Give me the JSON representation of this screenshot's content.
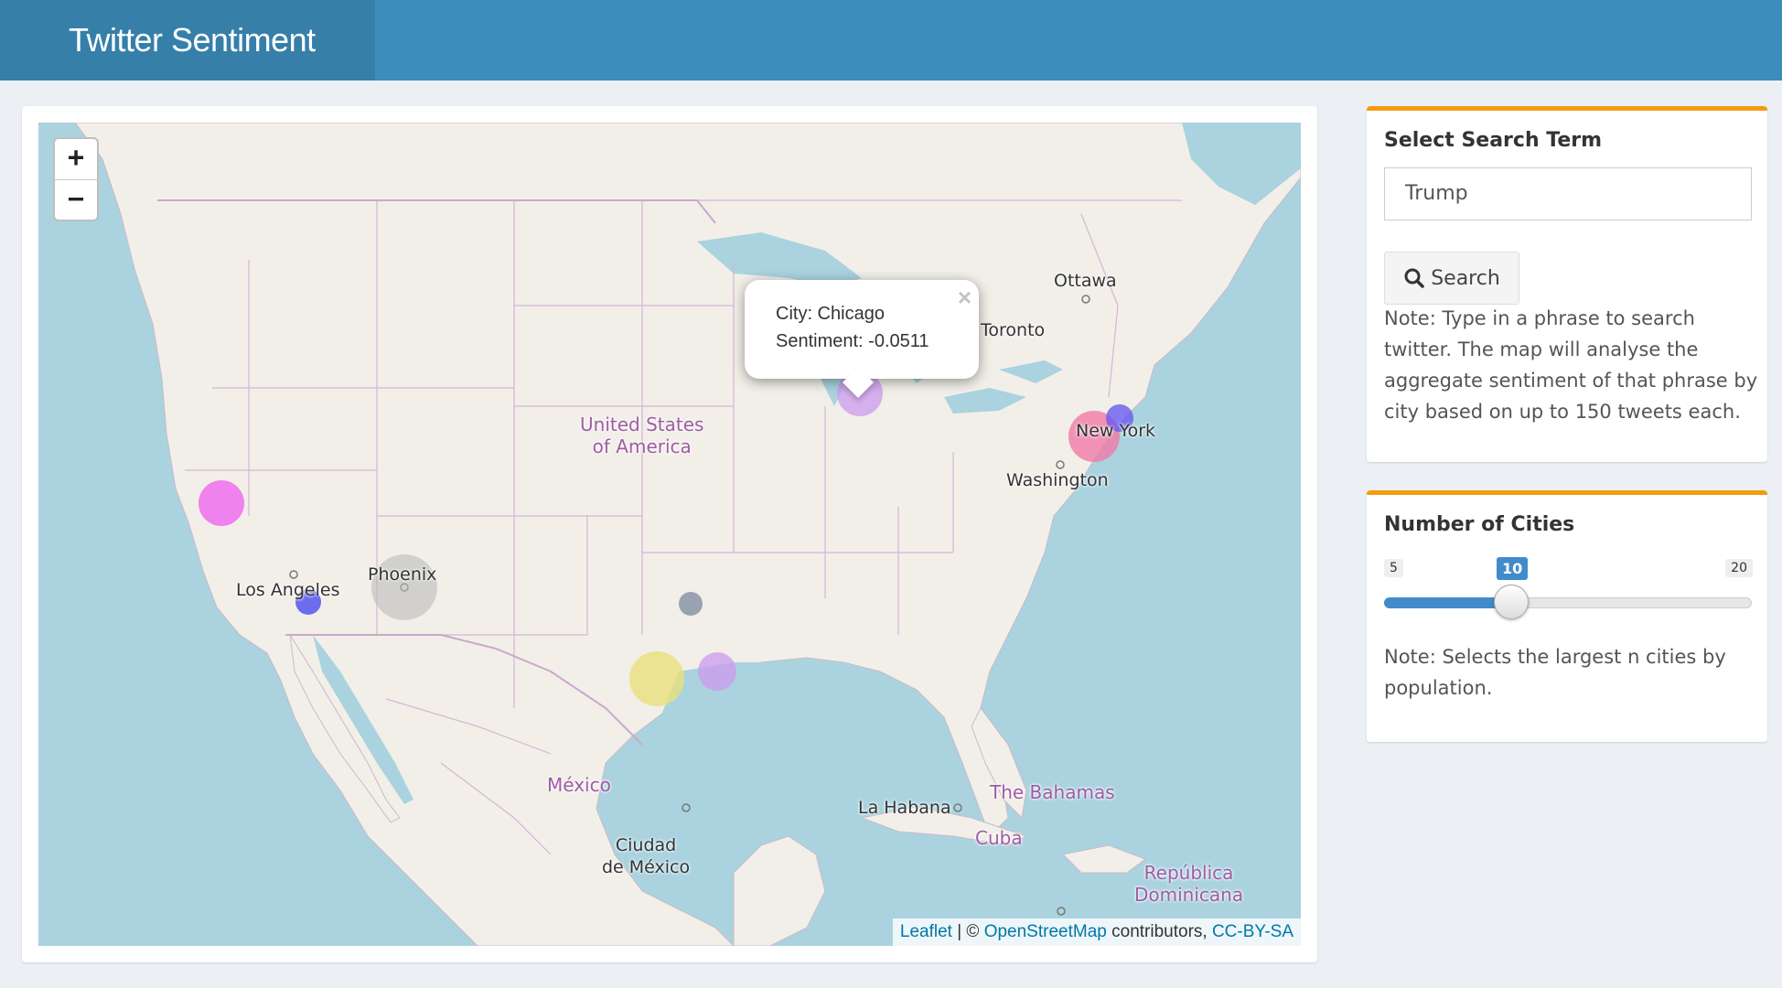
{
  "header": {
    "title": "Twitter Sentiment"
  },
  "map": {
    "zoom_in": "+",
    "zoom_out": "−",
    "labels": {
      "ottawa": "Ottawa",
      "toronto": "Toronto",
      "usa_line1": "United States",
      "usa_line2": "of America",
      "new_york": "New York",
      "washington": "Washington",
      "los_angeles": "Los Angeles",
      "phoenix": "Phoenix",
      "mexico": "México",
      "ciudad_line1": "Ciudad",
      "ciudad_line2": "de México",
      "la_habana": "La Habana",
      "bahamas": "The Bahamas",
      "cuba": "Cuba",
      "dominicana_line1": "República",
      "dominicana_line2": "Dominicana"
    },
    "popup": {
      "city": "City: Chicago",
      "sentiment": "Sentiment: -0.0511",
      "close": "×"
    },
    "attribution": {
      "leaflet": "Leaflet",
      "sep": " | © ",
      "osm": "OpenStreetMap",
      "contrib": " contributors, ",
      "license": "CC-BY-SA"
    },
    "markers": [
      {
        "name": "San Francisco",
        "color": "#ee66ee"
      },
      {
        "name": "Los Angeles",
        "color": "#5555ee"
      },
      {
        "name": "Phoenix",
        "color": "#bbbbbb"
      },
      {
        "name": "Dallas",
        "color": "#8894a6"
      },
      {
        "name": "San Antonio",
        "color": "#e8e07a"
      },
      {
        "name": "Houston",
        "color": "#cc99ee"
      },
      {
        "name": "Chicago",
        "color": "#cc99ee"
      },
      {
        "name": "New York",
        "color": "#f07aa8"
      },
      {
        "name": "New York 2",
        "color": "#6a5aee"
      }
    ]
  },
  "search_panel": {
    "title": "Select Search Term",
    "input_value": "Trump",
    "button_label": "Search",
    "note": "Note: Type in a phrase to search twitter. The map will analyse the aggregate sentiment of that phrase by city based on up to 150 tweets each."
  },
  "cities_panel": {
    "title": "Number of Cities",
    "min": "5",
    "max": "20",
    "value": "10",
    "note": "Note: Selects the largest n cities by population."
  }
}
